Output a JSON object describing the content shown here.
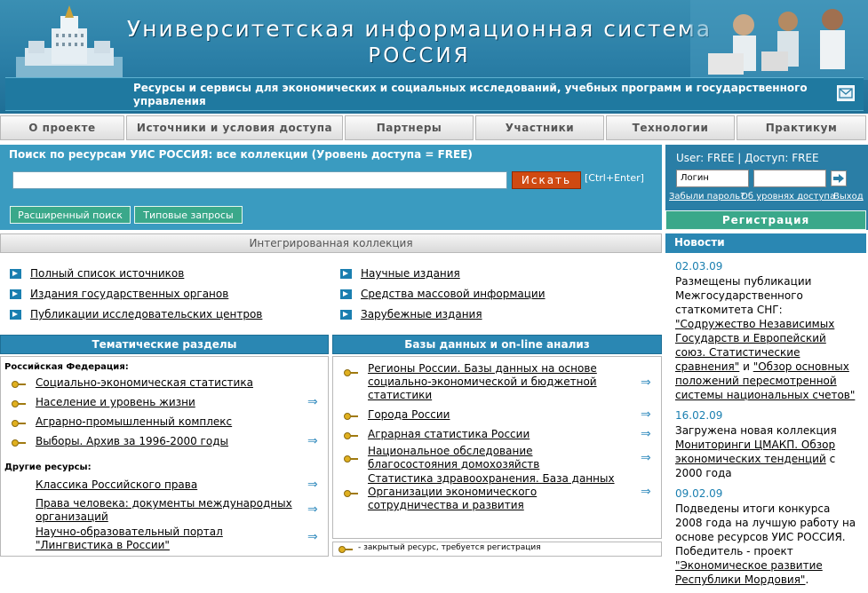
{
  "header": {
    "title_line1": "Университетская информационная система",
    "title_line2": "РОССИЯ",
    "subtitle": "Ресурсы и сервисы для экономических и социальных исследований, учебных программ и государственного управления",
    "mail_icon": "mail-icon"
  },
  "nav": {
    "items": [
      {
        "label": "О проекте"
      },
      {
        "label": "Источники и условия доступа"
      },
      {
        "label": "Партнеры"
      },
      {
        "label": "Участники"
      },
      {
        "label": "Технологии"
      },
      {
        "label": "Практикум"
      }
    ]
  },
  "search": {
    "title": "Поиск по ресурсам УИС РОССИЯ: все коллекции (Уровень доступа = FREE)",
    "input_value": "",
    "button_label": "Искать",
    "hint": "[Ctrl+Enter]",
    "advanced_label": "Расширенный поиск",
    "typical_label": "Типовые запросы"
  },
  "login": {
    "user_label": "User: FREE",
    "access_label": "Доступ: FREE",
    "login_placeholder": "Логин",
    "forgot": "Забыли пароль?",
    "levels": "Об уровнях доступа",
    "exit": "Выход",
    "register": "Регистрация"
  },
  "collection": {
    "title": "Интегрированная коллекция",
    "left": [
      "Полный список источников",
      "Издания государственных органов",
      "Публикации исследовательских центров"
    ],
    "right": [
      "Научные издания",
      "Средства массовой информации",
      "Зарубежные издания"
    ]
  },
  "thematic": {
    "title": "Тематические разделы",
    "rf_head": "Российская Федерация:",
    "rf_items": [
      "Социально-экономическая статистика",
      "Население и уровень жизни",
      "Аграрно-промышленный комплекс",
      "Выборы. Архив за 1996-2000 годы"
    ],
    "other_head": "Другие ресурсы:",
    "other_items": [
      "Классика Российского права",
      "Права человека: документы международных организаций",
      "Научно-образовательный портал \"Лингвистика в России\""
    ]
  },
  "databases": {
    "title": "Базы данных и on-line анализ",
    "items": [
      "Регионы России. Базы данных на основе социально-экономической и бюджетной статистики",
      "Города России",
      "Аграрная статистика России",
      "Национальное обследование благосостояния домохозяйств",
      "Статистика здравоохранения. База данных Организации экономического сотрудничества и развития"
    ],
    "legend": "- закрытый ресурс, требуется регистрация"
  },
  "news": {
    "title": "Новости",
    "items": [
      {
        "date": "02.03.09",
        "text_a": "Размещены публикации Межгосударственного статкомитета СНГ: ",
        "link1": "\"Содружество Независимых Государств и Европейский союз. Статистические сравнения\"",
        "text_b": " и ",
        "link2": "\"Обзор основных положений пересмотренной системы национальных счетов\""
      },
      {
        "date": "16.02.09",
        "text_a": "Загружена новая коллекция ",
        "link1": "Мониторинги ЦМАКП. Обзор экономических тенденций",
        "text_b": " с 2000 года"
      },
      {
        "date": "09.02.09",
        "text_a": "Подведены итоги конкурса 2008 года на лучшую работу на основе ресурсов УИС РОССИЯ. Победитель - проект ",
        "link1": "\"Экономическое развитие Республики Мордовия\"",
        "text_b": "."
      }
    ]
  }
}
